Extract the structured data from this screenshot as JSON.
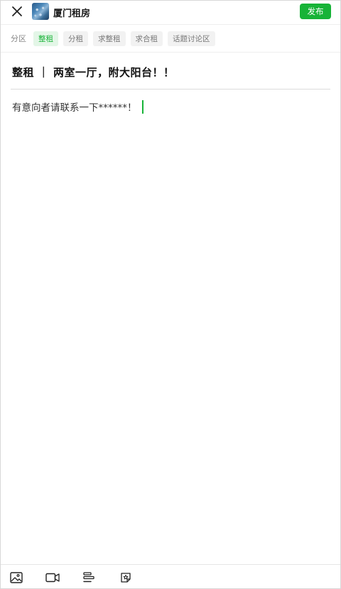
{
  "header": {
    "close_icon": "close-icon",
    "group_name": "厦门租房",
    "publish_label": "发布",
    "accent_color": "#17b337"
  },
  "category": {
    "label": "分区",
    "chips": [
      "整租",
      "分租",
      "求整租",
      "求合租",
      "话题讨论区"
    ],
    "selected": "整租"
  },
  "post": {
    "title": "整租 ｜ 两室一厅，附大阳台！！",
    "body": "有意向者请联系一下******！"
  },
  "toolbar": {
    "icons": [
      "image-icon",
      "video-icon",
      "format-icon",
      "sticker-icon"
    ]
  }
}
